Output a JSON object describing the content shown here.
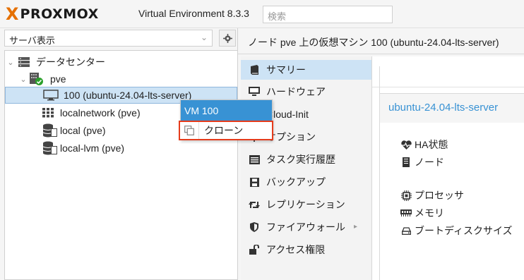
{
  "header": {
    "logo_x": "X",
    "logo_text": "PROXMOX",
    "version": "Virtual Environment 8.3.3",
    "search_placeholder": "検索"
  },
  "left": {
    "view_select": "サーバ表示",
    "tree": [
      {
        "label": "データセンター",
        "icon": "datacenter-icon",
        "level": 0,
        "selected": false
      },
      {
        "label": "pve",
        "icon": "node-online-icon",
        "level": 1,
        "selected": false
      },
      {
        "label": "100 (ubuntu-24.04-lts-server)",
        "icon": "vm-monitor-icon",
        "level": 2,
        "selected": true
      },
      {
        "label": "localnetwork (pve)",
        "icon": "network-grid-icon",
        "level": 2,
        "selected": false
      },
      {
        "label": "local (pve)",
        "icon": "storage-icon",
        "level": 2,
        "selected": false
      },
      {
        "label": "local-lvm (pve)",
        "icon": "storage-icon",
        "level": 2,
        "selected": false
      }
    ]
  },
  "context_menu": {
    "header": "VM 100",
    "items": [
      {
        "label": "クローン",
        "icon": "copy-icon"
      }
    ]
  },
  "content": {
    "title": "ノード pve 上の仮想マシン 100 (ubuntu-24.04-lts-server)",
    "nav": [
      {
        "label": "サマリー",
        "icon": "book-icon",
        "active": true
      },
      {
        "label": "ハードウェア",
        "icon": "monitor-icon",
        "active": false
      },
      {
        "label": "Cloud-Init",
        "icon": "cloud-icon",
        "active": false
      },
      {
        "label": "オプション",
        "icon": "gear-icon",
        "active": false
      },
      {
        "label": "タスク実行履歴",
        "icon": "list-icon",
        "active": false
      },
      {
        "label": "バックアップ",
        "icon": "floppy-icon",
        "active": false
      },
      {
        "label": "レプリケーション",
        "icon": "retweet-icon",
        "active": false
      },
      {
        "label": "ファイアウォール",
        "icon": "shield-icon",
        "active": false,
        "has_submenu": true
      },
      {
        "label": "アクセス権限",
        "icon": "unlock-icon",
        "active": false
      }
    ],
    "vm_name": "ubuntu-24.04-lts-server",
    "stats": [
      {
        "label": "HA状態",
        "icon": "heartbeat-icon"
      },
      {
        "label": "ノード",
        "icon": "server-icon"
      },
      {
        "label": "プロセッサ",
        "icon": "cpu-icon"
      },
      {
        "label": "メモリ",
        "icon": "memory-icon"
      },
      {
        "label": "ブートディスクサイズ",
        "icon": "hdd-icon"
      }
    ]
  }
}
